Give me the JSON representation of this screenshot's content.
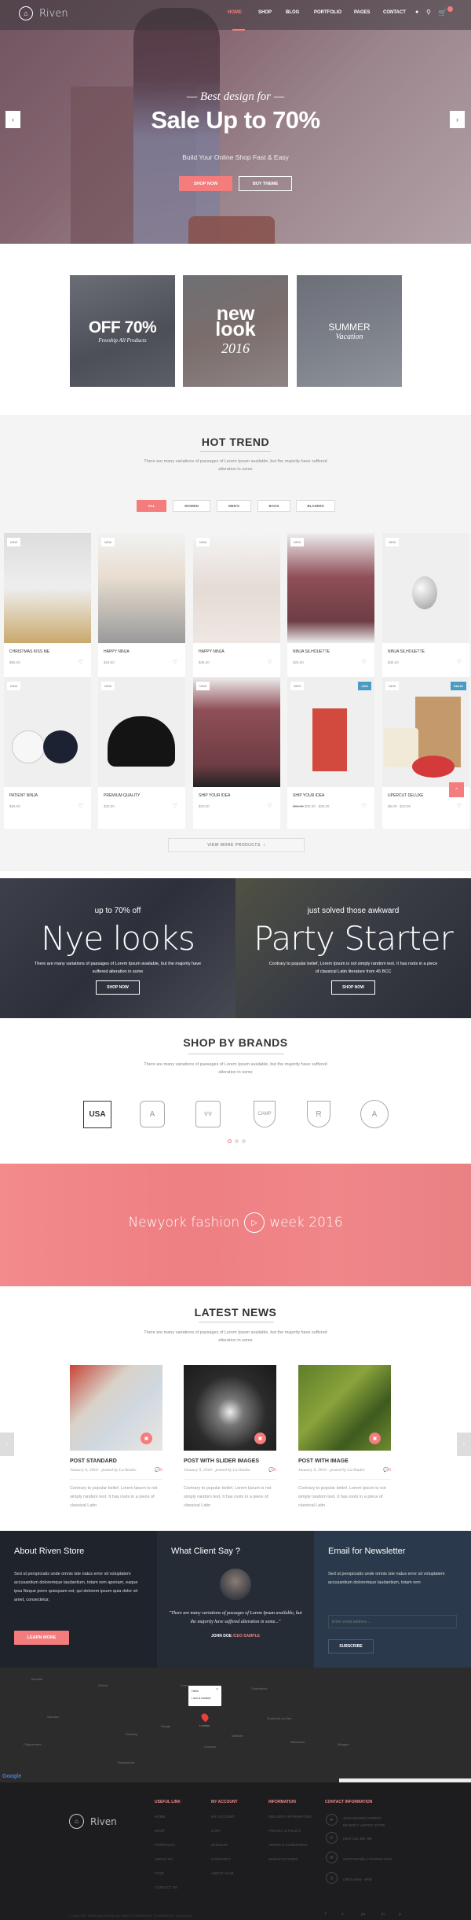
{
  "nav": {
    "logo_icon": "lock-icon",
    "logo_text": "Riven",
    "items": [
      "HOME",
      "SHOP",
      "BLOG",
      "PORTFOLIO",
      "PAGES",
      "CONTACT"
    ],
    "active": "HOME",
    "icons": [
      "user-icon",
      "search-icon",
      "cart-icon"
    ],
    "cart_count": "0"
  },
  "hero": {
    "subtitle": "Best design for",
    "title": "Sale Up to 70%",
    "tagline": "Build Your Online Shop Fast & Easy",
    "shop_now": "SHOP NOW",
    "buy_theme": "BUY THEME",
    "prev": "‹",
    "next": "›"
  },
  "promos": [
    {
      "line1": "OFF 70%",
      "line2": "Freeship All Products"
    },
    {
      "line1": "new",
      "line2": "look",
      "line3": "2016"
    },
    {
      "line1": "SUMMER",
      "line2": "Vacation"
    }
  ],
  "hot_trend": {
    "title": "HOT TREND",
    "desc": "There are many variations of passages of Lorem Ipsum available, but the majority have suffered alteration in some",
    "filters": [
      "ALL",
      "WOMEN",
      "MEN'S",
      "BAGS",
      "BLAZERS"
    ],
    "active_filter": "ALL",
    "products": [
      {
        "name": "CHRISTMAS KISS ME",
        "price": "$56.00",
        "badge": "NEW"
      },
      {
        "name": "HAPPY NINJA",
        "price": "$18.00",
        "badge": "NEW"
      },
      {
        "name": "HAPPY NINJA",
        "price": "$35.00",
        "badge": "NEW"
      },
      {
        "name": "NINJA SILHOUETTE",
        "price": "$20.00",
        "badge": "NEW"
      },
      {
        "name": "NINJA SILHOUETTE",
        "price": "$35.00",
        "badge": "NEW"
      },
      {
        "name": "PATIENT NINJA",
        "price": "$35.00",
        "badge": "NEW"
      },
      {
        "name": "PREMIUM QUALITY",
        "price": "$20.00",
        "badge": "NEW"
      },
      {
        "name": "SHIP YOUR IDEA",
        "price": "$20.00",
        "badge": "NEW"
      },
      {
        "name": "SHIP YOUR IDEA",
        "old_price": "$99.00",
        "price": "$30.00 - $35.00",
        "badge": "NEW",
        "sale_badge": "-14%"
      },
      {
        "name": "UPERCUT DELUXE",
        "price": "$8.00 - $10.00",
        "badge": "NEW",
        "sale_badge": "SALE!"
      }
    ],
    "view_more": "VIEW MORE PRODUCTS"
  },
  "banners": [
    {
      "small": "up to 70% off",
      "big": "Nye looks",
      "desc": "There are many variations of passages of Lorem Ipsum available, but the majority have suffered alteration in some",
      "button": "SHOP NOW"
    },
    {
      "small": "just solved those awkward",
      "big": "Party Starter",
      "desc": "Contrary to popular belief, Lorem Ipsum is not simply random text. It has roots in a piece of classical Latin literature from 45 BCC",
      "button": "SHOP NOW"
    }
  ],
  "brands": {
    "title": "SHOP BY BRANDS",
    "desc": "There are many variations of passages of Lorem Ipsum available, but the majority have suffered alteration in some",
    "logos": [
      "USA",
      "A",
      "BIKE",
      "CAMP",
      "R",
      "A"
    ],
    "pages": 3,
    "active_page": 1
  },
  "video": {
    "before": "Newyork fashion",
    "after": "week 2016"
  },
  "news": {
    "title": "LATEST NEWS",
    "desc": "There are many variations of passages of Lorem Ipsum available, but the majority have suffered alteration in some",
    "posts": [
      {
        "title": "POST STANDARD",
        "meta": "January 9, 2016 - posted by La-Studio",
        "comments": "0",
        "body": "Contrary to popular belief, Lorem Ipsum is not simply random text. It has roots in a piece of classical Latin"
      },
      {
        "title": "POST WITH SLIDER IMAGES",
        "meta": "January 9, 2016 - posted by La-Studio",
        "comments": "0",
        "body": "Contrary to popular belief, Lorem Ipsum is not simply random text. It has roots in a piece of classical Latin"
      },
      {
        "title": "POST WITH IMAGE",
        "meta": "January 9, 2016 - posted by La-Studio",
        "comments": "0",
        "body": "Contrary to popular belief, Lorem Ipsum is not simply random text. It has roots in a piece of classical Latin"
      }
    ]
  },
  "about": {
    "title": "About Riven Store",
    "text": "Sed ut perspiciatis unde omnis iste natus error sit voluptatem accusantium doloremque laudantium, totam rem aperiam, eaque ipsa Neque porro quisquam est, qui dolorem ipsum quia dolor sit amet, consectetur,",
    "button": "LEARN MORE"
  },
  "testimonial": {
    "title": "What Client Say ?",
    "quote": "\"There are many variations of passages of Lorem Ipsum available, but the majority have suffered alteration in some...\"",
    "author": "JOHN DOE",
    "role": "/CEO SAMPLE"
  },
  "newsletter": {
    "title": "Email for Newsletter",
    "text": "Sed ut perspiciatis unde omnis iste natus error sit voluptatem accusantium doloremque laudantium, totam rem",
    "placeholder": "Enter email address ...",
    "button": "SUBSCRIBE"
  },
  "map": {
    "popup_title": "Hello",
    "popup_text": "I am a marker",
    "close": "×",
    "city": "London",
    "brand": "Google"
  },
  "footer": {
    "logo_text": "Riven",
    "columns": [
      {
        "title": "USEFUL LINK",
        "links": [
          "HOME",
          "SHOP",
          "PORTFOLIO",
          "ABOUT US",
          "FAQS",
          "CONTACT US"
        ]
      },
      {
        "title": "MY ACCOUNT",
        "links": [
          "MY ACCOUNT",
          "CART",
          "WISHLIST",
          "CHECKOUT",
          "ABOUT CLUB"
        ]
      },
      {
        "title": "INFORMATION",
        "links": [
          "DELIVERY INFORMATION",
          "PRIVACY & POLICY",
          "TERMS & CONDITIONS",
          "MANUFACTURES"
        ]
      }
    ],
    "contact_title": "CONTACT INFORMATION",
    "contacts": [
      {
        "icon": "location-icon",
        "text": "1234 HEAVEN STREET, BEVERLY UNITED STATE"
      },
      {
        "icon": "phone-icon",
        "text": "(800) 123 456 789"
      },
      {
        "icon": "email-icon",
        "text": "SUPPORT@LA-STUDIO.COM"
      },
      {
        "icon": "clock-icon",
        "text": "OPEN 9AM - 9PM"
      }
    ],
    "copyright": "© 2016 THE TEMPLATE RIVEN. ALL RIGHTS RESERVED. POWERED BY LA-STUDIO",
    "social": [
      "f",
      "t",
      "g+",
      "in",
      "p"
    ]
  },
  "colors": {
    "accent": "#f47c7c",
    "sale": "#4a9cc4",
    "dark": "#222831",
    "footer": "#1d1d1f"
  }
}
